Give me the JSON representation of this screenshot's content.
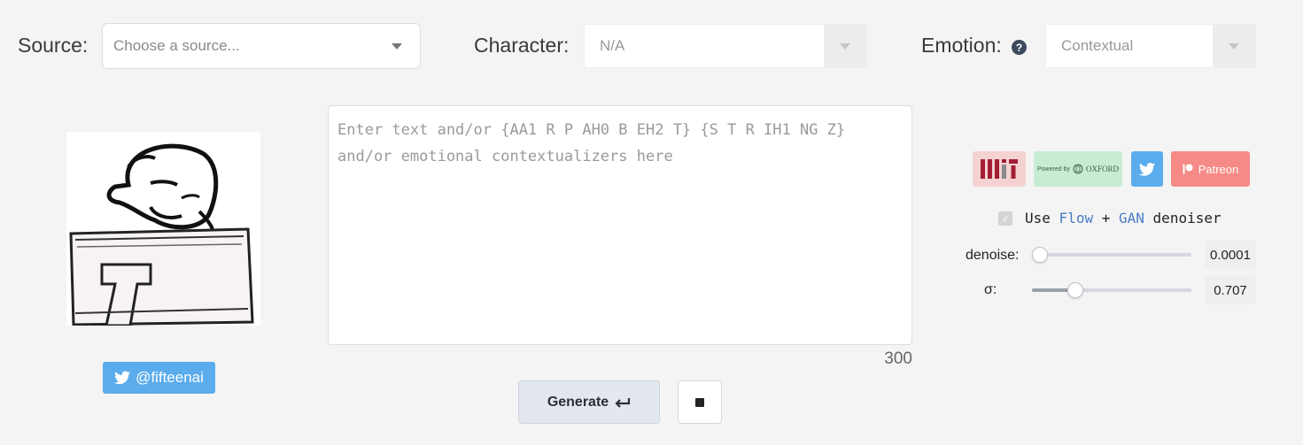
{
  "source": {
    "label": "Source:",
    "placeholder": "Choose a source..."
  },
  "character": {
    "label": "Character:",
    "value": "N/A"
  },
  "emotion": {
    "label": "Emotion:",
    "value": "Contextual",
    "help_icon": "question-circle-icon"
  },
  "avatar": {
    "alt": "Character portrait"
  },
  "twitter_handle": "@fifteenai",
  "textarea": {
    "placeholder": "Enter text and/or {AA1 R P AH0 B EH2 T} {S T R IH1 NG Z}\nand/or emotional contextualizers here"
  },
  "char_count": "300",
  "generate_label": "Generate",
  "badges": {
    "mit": "MIT",
    "oxford_powered": "Powered by",
    "oxford_name": "OXFORD",
    "patreon": "Patreon"
  },
  "denoiser": {
    "use": "Use",
    "flow": "Flow",
    "plus": "+",
    "gan": "GAN",
    "tail": "denoiser",
    "checked": true
  },
  "sliders": [
    {
      "label": "denoise:",
      "value": "0.0001",
      "fraction": 0.04
    },
    {
      "label": "σ:",
      "value": "0.707",
      "fraction": 0.27
    }
  ],
  "colors": {
    "twitter": "#5aacec",
    "patreon": "#f58a86",
    "accent": "#4a7cc7"
  }
}
